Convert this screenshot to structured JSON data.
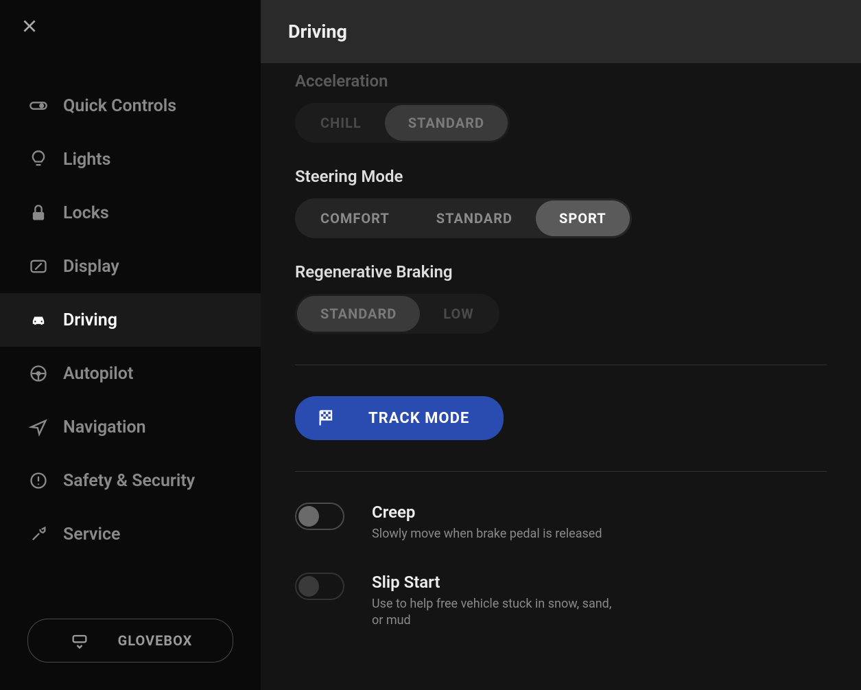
{
  "sidebar": {
    "items": [
      {
        "label": "Quick Controls",
        "icon": "toggle-icon"
      },
      {
        "label": "Lights",
        "icon": "bulb-icon"
      },
      {
        "label": "Locks",
        "icon": "lock-icon"
      },
      {
        "label": "Display",
        "icon": "display-icon"
      },
      {
        "label": "Driving",
        "icon": "car-icon",
        "active": true
      },
      {
        "label": "Autopilot",
        "icon": "wheel-icon"
      },
      {
        "label": "Navigation",
        "icon": "nav-icon"
      },
      {
        "label": "Safety & Security",
        "icon": "alert-icon"
      },
      {
        "label": "Service",
        "icon": "wrench-icon"
      }
    ],
    "glovebox": "GLOVEBOX"
  },
  "header": {
    "title": "Driving"
  },
  "acceleration": {
    "label": "Acceleration",
    "options": [
      "CHILL",
      "STANDARD"
    ],
    "selected": 1
  },
  "steering": {
    "label": "Steering Mode",
    "options": [
      "COMFORT",
      "STANDARD",
      "SPORT"
    ],
    "selected": 2
  },
  "regen": {
    "label": "Regenerative Braking",
    "options": [
      "STANDARD",
      "LOW"
    ],
    "selected": 0
  },
  "track": {
    "label": "TRACK MODE"
  },
  "toggles": {
    "creep": {
      "title": "Creep",
      "desc": "Slowly move when brake pedal is released",
      "on": false
    },
    "slip": {
      "title": "Slip Start",
      "desc": "Use to help free vehicle stuck in snow, sand, or mud",
      "on": false
    }
  }
}
